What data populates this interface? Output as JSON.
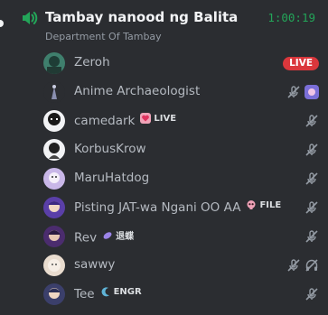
{
  "channel": {
    "name": "Tambay nanood ng Balita",
    "subtitle": "Department Of Tambay",
    "timer": "1:00:19"
  },
  "users": [
    {
      "name": "Zeroh",
      "live_label": "LIVE"
    },
    {
      "name": "Anime Archaeologist"
    },
    {
      "name": "camedark",
      "badge": "LIVE"
    },
    {
      "name": "KorbusKrow"
    },
    {
      "name": "MaruHatdog"
    },
    {
      "name": "Pisting JAT-wa Ngani OO AA",
      "badge": "FILE"
    },
    {
      "name": "Rev",
      "badge": "退蝶"
    },
    {
      "name": "sawwy"
    },
    {
      "name": "Tee",
      "badge": "ENGR"
    }
  ],
  "colors": {
    "background": "#2b2d31",
    "timer_green": "#23a559",
    "live_red": "#da373c",
    "muted_icon": "#949ba4"
  },
  "icons": {
    "speaker": "speaker-icon",
    "mute": "mic-muted-icon",
    "deafen": "headphones-muted-icon"
  }
}
